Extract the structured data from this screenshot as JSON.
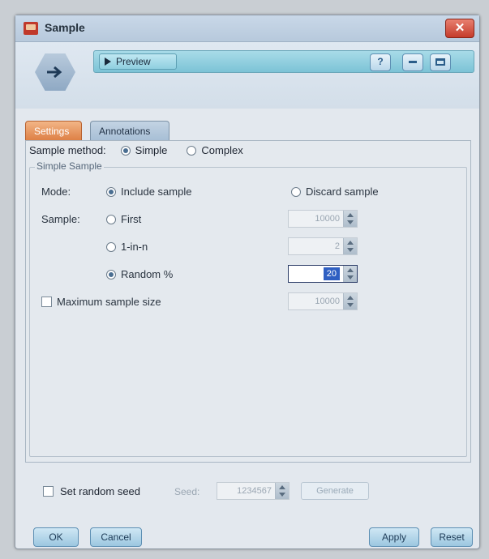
{
  "window": {
    "title": "Sample",
    "close_symbol": "✕"
  },
  "toolbar": {
    "preview_label": "Preview",
    "help_symbol": "?"
  },
  "tabs": [
    {
      "label": "Settings",
      "active": true
    },
    {
      "label": "Annotations",
      "active": false
    }
  ],
  "method": {
    "label": "Sample method:",
    "options": [
      {
        "label": "Simple",
        "selected": true
      },
      {
        "label": "Complex",
        "selected": false
      }
    ]
  },
  "simple_sample": {
    "group_label": "Simple Sample",
    "mode_label": "Mode:",
    "mode_options": [
      {
        "label": "Include sample",
        "selected": true
      },
      {
        "label": "Discard sample",
        "selected": false
      }
    ],
    "sample_label": "Sample:",
    "sample_options": [
      {
        "label": "First",
        "selected": false,
        "value": "10000",
        "enabled": false
      },
      {
        "label": "1-in-n",
        "selected": false,
        "value": "2",
        "enabled": false
      },
      {
        "label": "Random %",
        "selected": true,
        "value": "20",
        "enabled": true
      }
    ],
    "max_size_label": "Maximum sample size",
    "max_size_checked": false,
    "max_size_value": "10000"
  },
  "seed": {
    "label": "Set random seed",
    "checked": false,
    "seed_label": "Seed:",
    "seed_value": "1234567",
    "generate_label": "Generate"
  },
  "footer": {
    "ok_label": "OK",
    "cancel_label": "Cancel",
    "apply_label": "Apply",
    "reset_label": "Reset"
  },
  "colors": {
    "titlebar": "#b7c9dc",
    "active_tab": "#dd7e43",
    "preview_bar": "#7cc3d6",
    "close_button": "#c53b2b"
  }
}
